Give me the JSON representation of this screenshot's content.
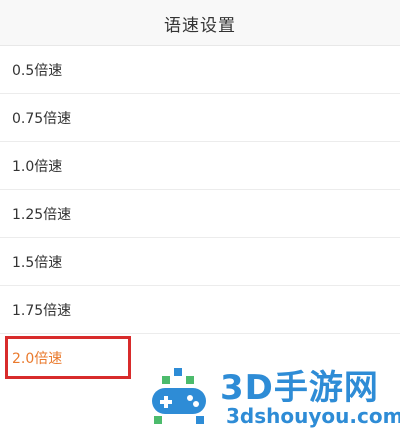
{
  "header": {
    "title": "语速设置"
  },
  "speed_options": [
    {
      "label": "0.5倍速",
      "selected": false
    },
    {
      "label": "0.75倍速",
      "selected": false
    },
    {
      "label": "1.0倍速",
      "selected": false
    },
    {
      "label": "1.25倍速",
      "selected": false
    },
    {
      "label": "1.5倍速",
      "selected": false
    },
    {
      "label": "1.75倍速",
      "selected": false
    },
    {
      "label": "2.0倍速",
      "selected": true
    }
  ],
  "colors": {
    "selected_text": "#ea7a2d",
    "highlight_box": "#d82b2b",
    "watermark_blue": "#2e8cd6",
    "watermark_green": "#4cbb6c"
  },
  "watermark": {
    "title": "3D手游网",
    "url": "3dshouyou.com",
    "icon": "game-controller-logo-icon"
  }
}
